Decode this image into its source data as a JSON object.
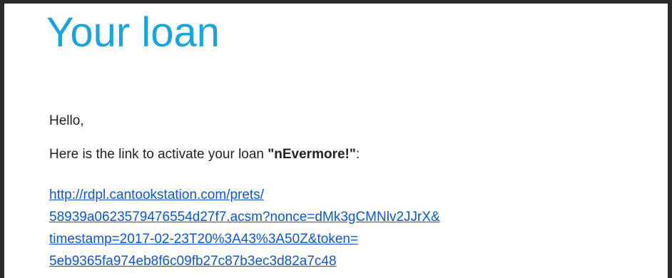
{
  "email": {
    "heading": "Your loan",
    "greeting": "Hello,",
    "message_prefix": "Here is the link to activate your loan ",
    "book_title": "\"nEvermore!\"",
    "message_suffix": ":",
    "activation_link": {
      "lines": [
        "http://rdpl.cantookstation.com/prets/",
        "58939a0623579476554d27f7.acsm?nonce=dMk3gCMNlv2JJrX&",
        "timestamp=2017-02-23T20%3A43%3A50Z&token=",
        "5eb9365fa974eb8f6c09fb27c87b3ec3d82a7c48"
      ]
    }
  },
  "colors": {
    "heading": "#1aa3dc",
    "link": "#1155cc",
    "text": "#222222",
    "frame": "#2b2b2b"
  }
}
